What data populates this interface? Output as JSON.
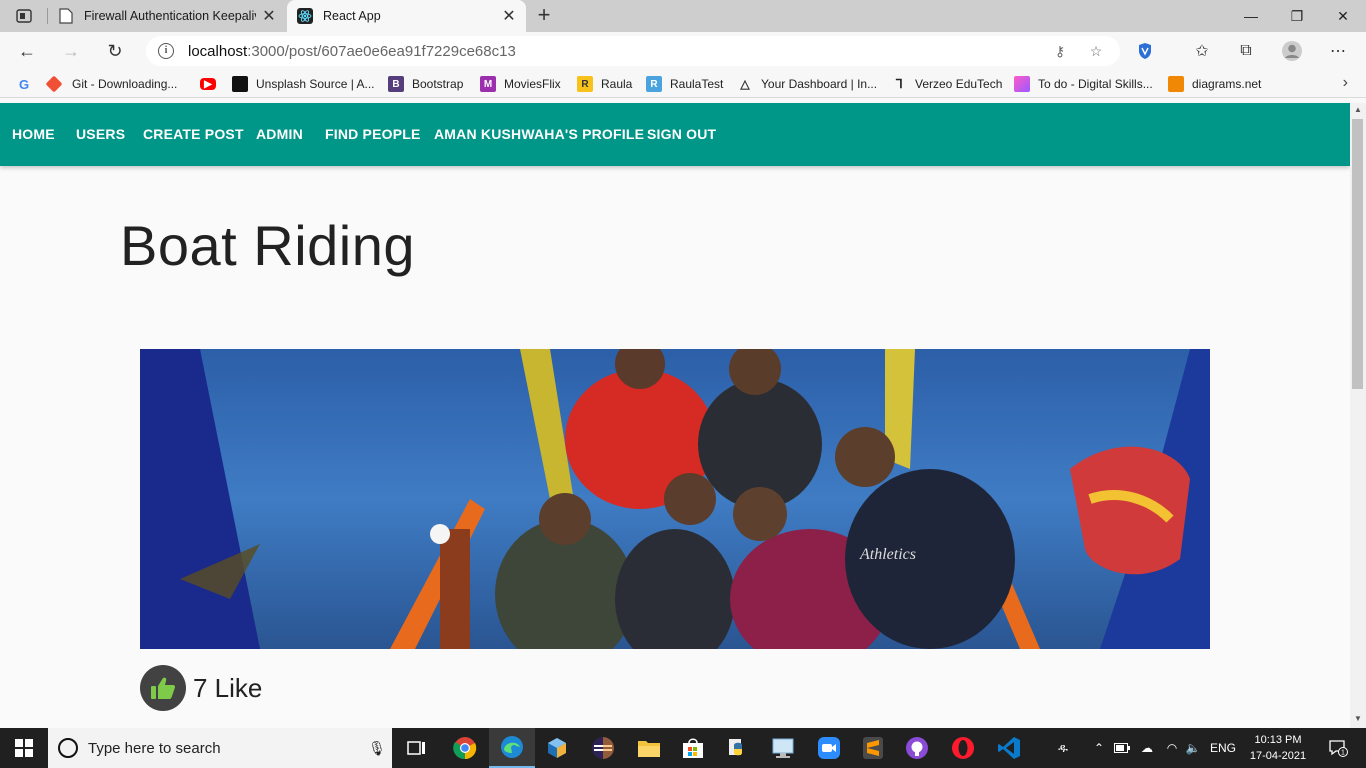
{
  "browser": {
    "tabs": [
      {
        "title": "Firewall Authentication Keepalive",
        "active": false
      },
      {
        "title": "React App",
        "active": true
      }
    ],
    "url_host": "localhost",
    "url_rest": ":3000/post/607ae0e6ea91f7229ce68c13",
    "bookmarks": [
      {
        "label": "",
        "icon": "google-icon",
        "color": "#ffffff"
      },
      {
        "label": "Git - Downloading...",
        "icon": "git-icon",
        "color": "#f05033"
      },
      {
        "label": "",
        "icon": "youtube-icon",
        "color": "#ff0000"
      },
      {
        "label": "Unsplash Source | A...",
        "icon": "unsplash-icon",
        "color": "#111111"
      },
      {
        "label": "Bootstrap",
        "icon": "bootstrap-icon",
        "color": "#563d7c"
      },
      {
        "label": "MoviesFlix",
        "icon": "moviesflix-icon",
        "color": "#9b2fae"
      },
      {
        "label": "Raula",
        "icon": "raula-icon",
        "color": "#f7c31b"
      },
      {
        "label": "RaulaTest",
        "icon": "raulatest-icon",
        "color": "#4aa3df"
      },
      {
        "label": "Your Dashboard | In...",
        "icon": "dashboard-icon",
        "color": "#333333"
      },
      {
        "label": "Verzeo EduTech",
        "icon": "verzeo-icon",
        "color": "#222222"
      },
      {
        "label": "To do - Digital Skills...",
        "icon": "todo-icon",
        "color": "#e91e63"
      },
      {
        "label": "diagrams.net",
        "icon": "diagrams-icon",
        "color": "#f08705"
      }
    ]
  },
  "app": {
    "brand_color": "#009688",
    "nav": [
      "HOME",
      "USERS",
      "CREATE POST",
      "ADMIN",
      "FIND PEOPLE",
      "AMAN KUSHWAHA'S PROFILE",
      "SIGN OUT"
    ],
    "post": {
      "title": "Boat Riding",
      "likes_label": "7 Like"
    }
  },
  "taskbar": {
    "search_placeholder": "Type here to search",
    "language": "ENG",
    "time": "10:13 PM",
    "date": "17-04-2021",
    "notification_count": "1"
  }
}
